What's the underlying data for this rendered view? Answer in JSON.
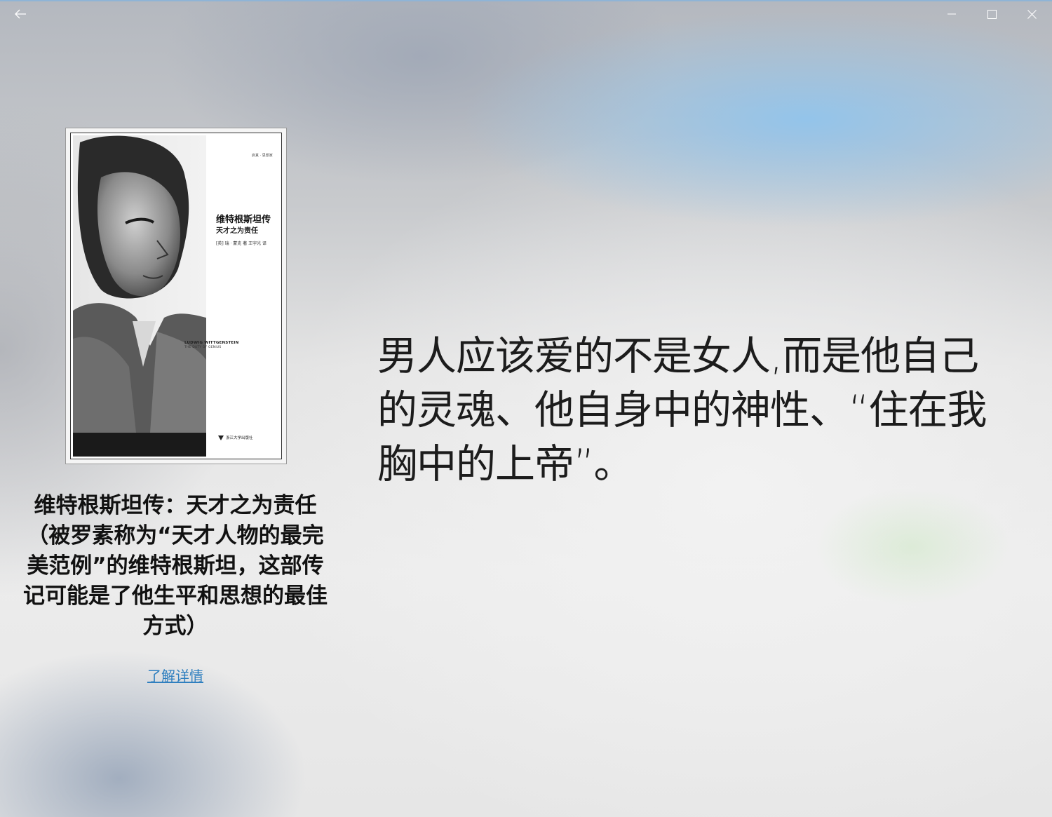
{
  "window": {
    "back_icon": "arrow-left-icon",
    "minimize_icon": "minimize-icon",
    "maximize_icon": "maximize-icon",
    "close_icon": "close-icon"
  },
  "cover": {
    "series": "启真 · 思想家",
    "title": "维特根斯坦传",
    "subtitle": "天才之为责任",
    "author": "[英] 瑞 · 蒙克 著   王宇光 译",
    "en_title": "LUDWIG WITTGENSTEIN",
    "en_subtitle": "THE DUTY OF GENIUS",
    "publisher": "浙江大学出版社"
  },
  "book": {
    "title": "维特根斯坦传：天才之为责任（被罗素称为“天才人物的最完美范例”的维特根斯坦，这部传记可能是了他生平和思想的最佳方式）",
    "link_label": "了解详情"
  },
  "quote": {
    "text": "男人应该爱的不是女人,而是他自己的灵魂、他自身中的神性、“住在我胸中的上帝”。"
  },
  "colors": {
    "link": "#2f7fbf",
    "text": "#1c1c1c",
    "accent_line": "#8fb4d6"
  }
}
